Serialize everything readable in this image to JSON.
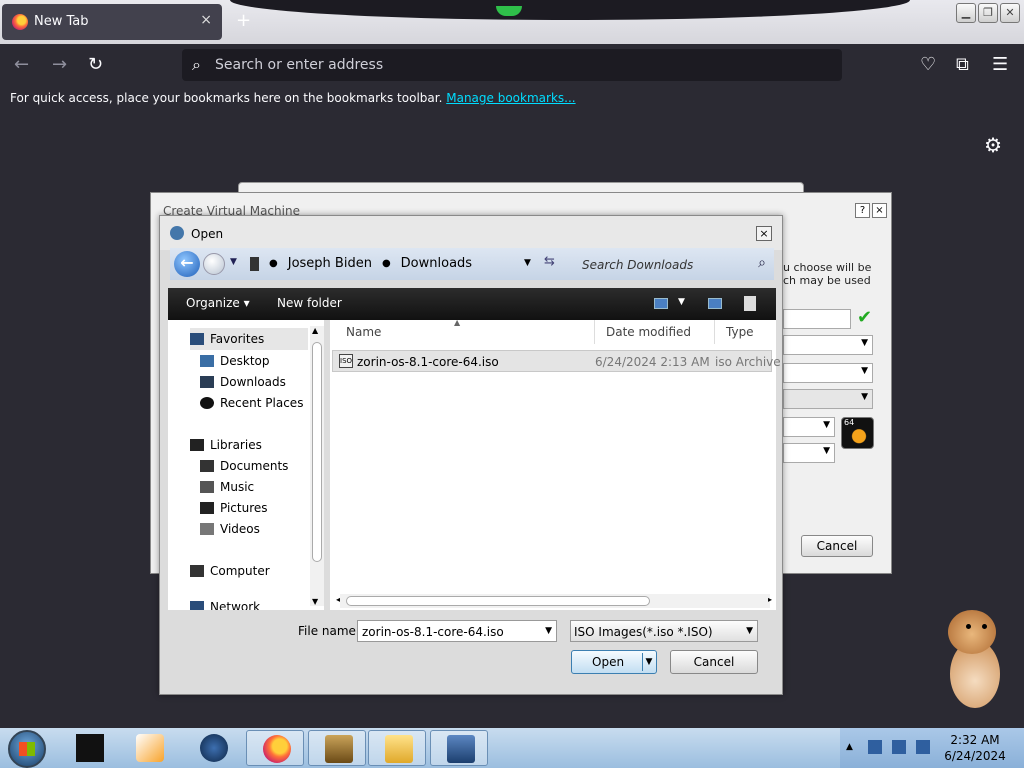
{
  "browser": {
    "tab_title": "New Tab",
    "tab_close": "×",
    "new_tab": "+",
    "address_placeholder": "Search or enter address",
    "bookmarks_message": "For quick access, place your bookmarks here on the bookmarks toolbar.",
    "manage_bookmarks": "Manage bookmarks..."
  },
  "bg_dialog": {
    "title": "Create Virtual Machine",
    "help": "?",
    "close": "×",
    "text_line1": "u choose will be",
    "text_line2": "ch may be used",
    "os_badge": "64",
    "cancel": "Cancel"
  },
  "open_dialog": {
    "title": "Open",
    "close": "×",
    "breadcrumb": [
      "Joseph Biden",
      "Downloads"
    ],
    "search_placeholder": "Search Downloads",
    "toolbar": {
      "organize": "Organize",
      "new_folder": "New folder"
    },
    "nav": {
      "favorites": "Favorites",
      "desktop": "Desktop",
      "downloads": "Downloads",
      "recent_places": "Recent Places",
      "libraries": "Libraries",
      "documents": "Documents",
      "music": "Music",
      "pictures": "Pictures",
      "videos": "Videos",
      "computer": "Computer",
      "network": "Network"
    },
    "columns": {
      "name": "Name",
      "date_modified": "Date modified",
      "type": "Type"
    },
    "files": [
      {
        "icon": "ISO",
        "name": "zorin-os-8.1-core-64.iso",
        "date": "6/24/2024 2:13 AM",
        "type": "iso Archive"
      }
    ],
    "file_name_label": "File name:",
    "file_name_value": "zorin-os-8.1-core-64.iso",
    "file_type_value": "ISO Images(*.iso *.ISO)",
    "open_button": "Open",
    "cancel_button": "Cancel"
  },
  "taskbar": {
    "time": "2:32 AM",
    "date": "6/24/2024"
  },
  "icons": {
    "firefox": "firefox-icon",
    "search": "⌕",
    "back": "←",
    "forward": "→",
    "reload": "↻",
    "pocket": "♡",
    "extensions": "⧉",
    "menu": "☰",
    "settings": "⚙"
  },
  "colors": {
    "browser_bg": "#2b2a33",
    "link": "#00ddff",
    "taskbar": "#9bbedf"
  }
}
